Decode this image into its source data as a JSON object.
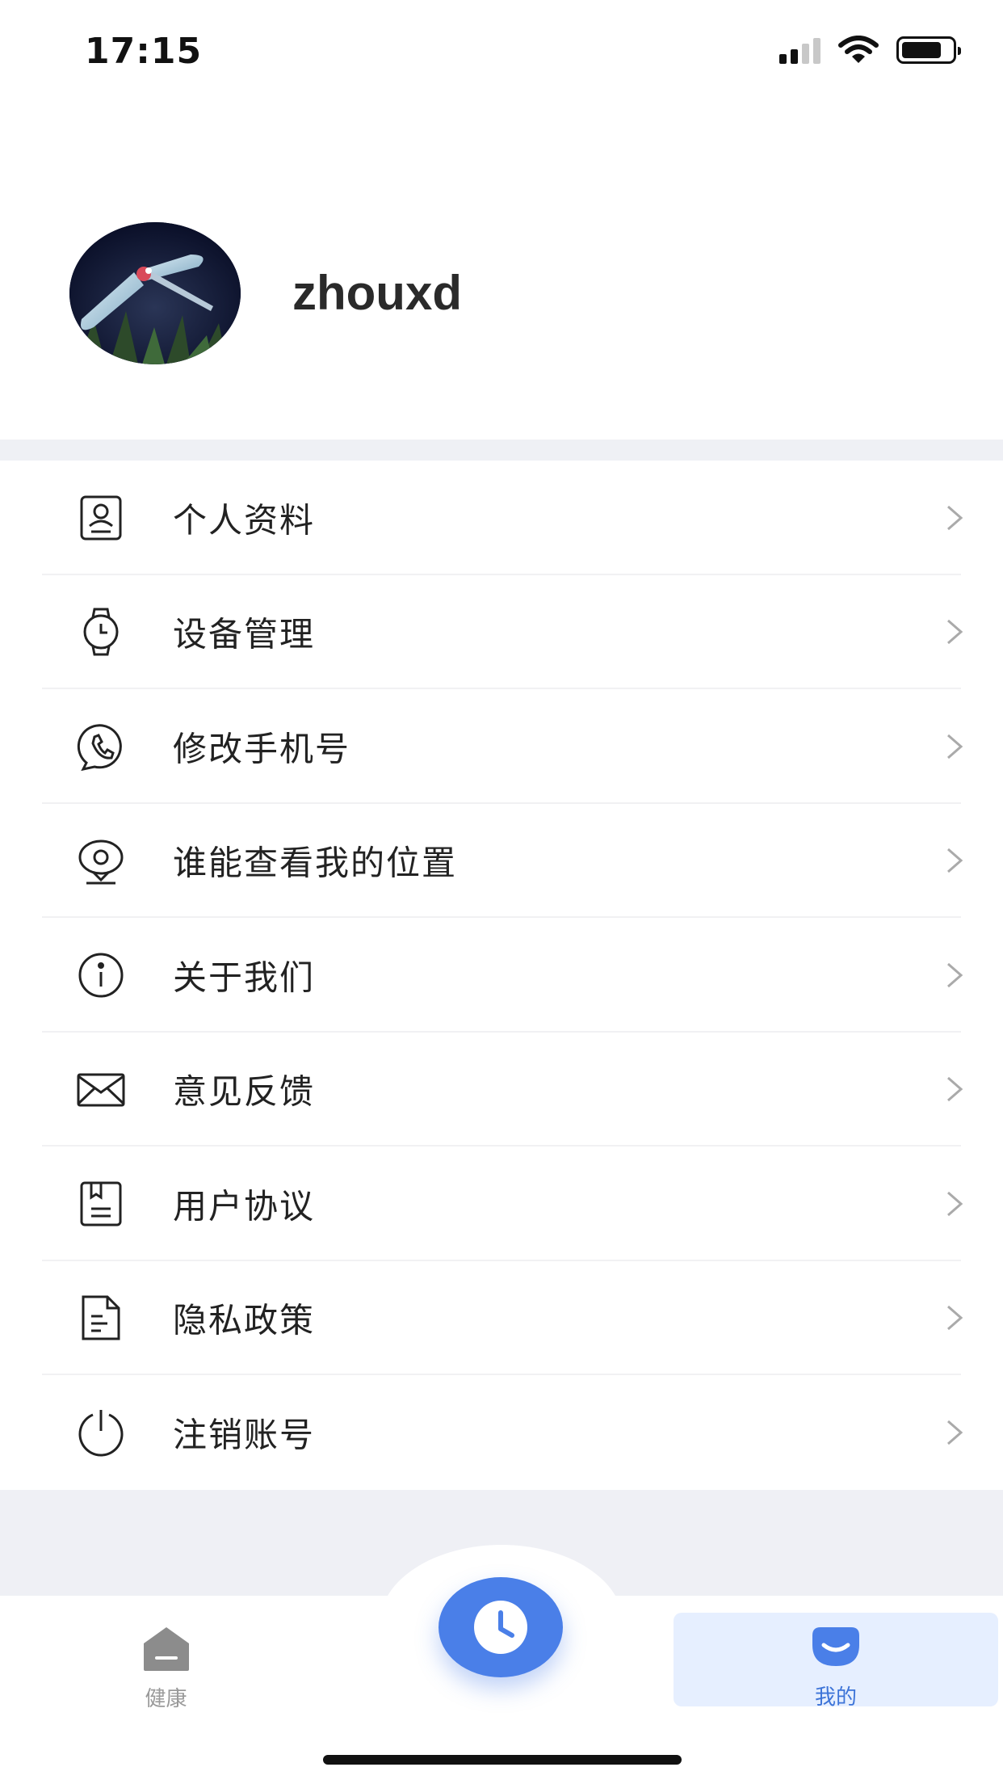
{
  "status_bar": {
    "time": "17:15"
  },
  "profile": {
    "username": "zhouxd"
  },
  "menu": [
    {
      "label": "个人资料",
      "icon": "profile-card-icon"
    },
    {
      "label": "设备管理",
      "icon": "watch-icon"
    },
    {
      "label": "修改手机号",
      "icon": "phone-icon"
    },
    {
      "label": "谁能查看我的位置",
      "icon": "location-eye-icon"
    },
    {
      "label": "关于我们",
      "icon": "info-icon"
    },
    {
      "label": "意见反馈",
      "icon": "mail-icon"
    },
    {
      "label": "用户协议",
      "icon": "agreement-icon"
    },
    {
      "label": "隐私政策",
      "icon": "document-icon"
    },
    {
      "label": "注销账号",
      "icon": "power-icon"
    }
  ],
  "tabbar": {
    "health_label": "健康",
    "mine_label": "我的",
    "center_icon": "clock-icon"
  },
  "colors": {
    "accent": "#4a7fe8",
    "active_tab_bg": "#e6efff",
    "active_tab_text": "#3d74d8",
    "page_gray": "#eff0f5"
  }
}
